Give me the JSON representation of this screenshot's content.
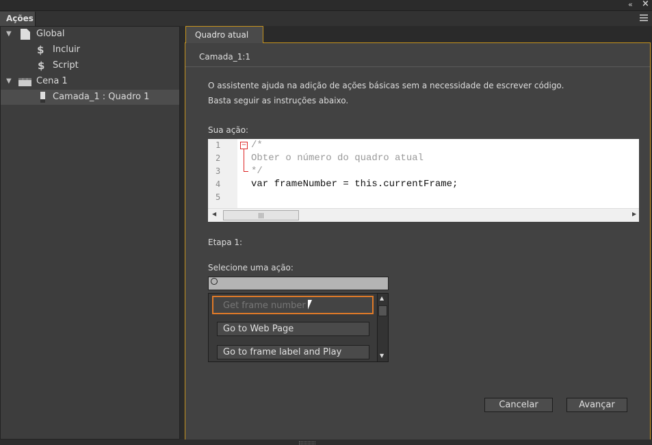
{
  "topbar": {
    "collapse_icon": "«",
    "close_icon": "×"
  },
  "panel_tab": "Ações",
  "tree": [
    {
      "label": "Global",
      "icon": "file-icon"
    },
    {
      "label": "Incluir",
      "icon": "include-script-icon"
    },
    {
      "label": "Script",
      "icon": "script-icon"
    },
    {
      "label": "Cena 1",
      "icon": "scene-clapper-icon"
    },
    {
      "label": "Camada_1 : Quadro 1",
      "icon": "frame-icon"
    }
  ],
  "right": {
    "tab": "Quadro atual",
    "subtitle": "Camada_1:1",
    "intro1": "O assistente ajuda na adição de ações básicas sem a necessidade de escrever código.",
    "intro2": "Basta seguir as instruções abaixo.",
    "your_action_label": "Sua ação:",
    "code_lines": [
      "/*",
      "Obter o número do quadro atual",
      "*/",
      "var frameNumber = this.currentFrame;",
      ""
    ],
    "line_numbers": [
      "1",
      "2",
      "3",
      "4",
      "5"
    ],
    "step_label": "Etapa 1:",
    "select_label": "Selecione uma ação:",
    "search_value": "",
    "actions": [
      "Get frame number",
      "Go to Web Page",
      "Go to frame label and Play"
    ],
    "cancel": "Cancelar",
    "next": "Avançar"
  },
  "colors": {
    "accent": "#c8951e",
    "highlight": "#e07a28"
  }
}
